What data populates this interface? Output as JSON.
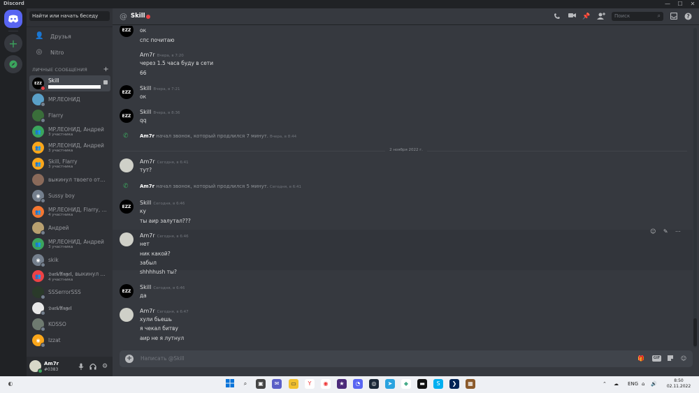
{
  "app": {
    "title": "Discord",
    "window_controls": [
      "—",
      "☐",
      "✕"
    ]
  },
  "guilds": {
    "home_icon": "discord-logo-icon",
    "add_icon": "plus-icon",
    "explore_icon": "compass-icon"
  },
  "sidebar": {
    "search_placeholder": "Найти или начать беседу",
    "nav": [
      {
        "label": "Друзья",
        "icon": "friends-icon"
      },
      {
        "label": "Nitro",
        "icon": "nitro-icon"
      }
    ],
    "dm_header": "ЛИЧНЫЕ СООБЩЕНИЯ",
    "dm_add": "+",
    "dms": [
      {
        "name": "Skill",
        "sub": "",
        "color": "#000000",
        "status": "dnd",
        "active": true,
        "avatar_text": "EZZ"
      },
      {
        "name": "MP.ЛЕОНИД",
        "sub": "",
        "color": "#5aa0c8",
        "status": "offline",
        "active": false,
        "avatar_text": ""
      },
      {
        "name": "Flarry",
        "sub": "",
        "color": "#3a6e3a",
        "status": "offline",
        "active": false,
        "avatar_text": ""
      },
      {
        "name": "MP.ЛЕОНИД, Андрей",
        "sub": "3 участника",
        "color": "#3ba55d",
        "status": "",
        "active": false,
        "avatar_text": "👥"
      },
      {
        "name": "MP.ЛЕОНИД, Андрей",
        "sub": "3 участника",
        "color": "#faa61a",
        "status": "",
        "active": false,
        "avatar_text": "👥"
      },
      {
        "name": "Skill, Flarry",
        "sub": "3 участника",
        "color": "#faa61a",
        "status": "",
        "active": false,
        "avatar_text": "👥"
      },
      {
        "name": "выкинул твоего отчи...",
        "sub": "",
        "color": "#8a6a5a",
        "status": "",
        "active": false,
        "avatar_text": ""
      },
      {
        "name": "Sussy boy",
        "sub": "",
        "color": "#747f8d",
        "status": "offline",
        "active": false,
        "avatar_text": "◉"
      },
      {
        "name": "MP.ЛЕОНИД, Flarry, ...",
        "sub": "4 участника",
        "color": "#f57731",
        "status": "",
        "active": false,
        "avatar_text": "👥"
      },
      {
        "name": "Андрей",
        "sub": "",
        "color": "#b8a070",
        "status": "offline",
        "active": false,
        "avatar_text": ""
      },
      {
        "name": "MP.ЛЕОНИД, Андрей",
        "sub": "3 участника",
        "color": "#3ba55d",
        "status": "",
        "active": false,
        "avatar_text": "👥"
      },
      {
        "name": "skik",
        "sub": "",
        "color": "#747f8d",
        "status": "offline",
        "active": false,
        "avatar_text": "◉"
      },
      {
        "name": "𝕯𝖆𝖗𝖐𝕬𝖓𝖌𝖊𝖑, выкинул ...",
        "sub": "4 участника",
        "color": "#ed4245",
        "status": "",
        "active": false,
        "avatar_text": "👥"
      },
      {
        "name": "SSSerrorSSS",
        "sub": "",
        "color": "#2a3a2a",
        "status": "mobile",
        "active": false,
        "avatar_text": ""
      },
      {
        "name": "𝕯𝖆𝖗𝖐𝕬𝖓𝖌𝖊𝖑",
        "sub": "",
        "color": "#e8e8e8",
        "status": "offline",
        "active": false,
        "avatar_text": ""
      },
      {
        "name": "KOSSO",
        "sub": "",
        "color": "#6e7a70",
        "status": "offline",
        "active": false,
        "avatar_text": ""
      },
      {
        "name": "Izzat",
        "sub": "",
        "color": "#faa61a",
        "status": "offline",
        "active": false,
        "avatar_text": "◉"
      }
    ]
  },
  "user_panel": {
    "username": "Am7r",
    "tag": "#0383",
    "mic_icon": "microphone-icon",
    "headphones_icon": "headphones-icon",
    "settings_icon": "gear-icon"
  },
  "channel": {
    "at": "@",
    "title": "Skill",
    "search_placeholder": "Поиск"
  },
  "messages": {
    "top_lines": [
      "ок",
      "спс почитаю"
    ],
    "m1": {
      "author": "Am7r",
      "time": "Вчера, в 7:20",
      "lines": [
        "через 1.5 часа буду в сети",
        "66"
      ]
    },
    "m2": {
      "author": "Skill",
      "time": "Вчера, в 7:21",
      "lines": [
        "ок"
      ]
    },
    "m3": {
      "author": "Skill",
      "time": "Вчера, в 8:36",
      "lines": [
        "qq"
      ]
    },
    "call1": {
      "author": "Am7r",
      "text": "начал звонок, который продлился 7 минут.",
      "time": "Вчера, в 8:44"
    },
    "date_divider": "2 ноября 2022 г.",
    "m4": {
      "author": "Am7r",
      "time": "Сегодня, в 6:41",
      "lines": [
        "тут?"
      ]
    },
    "call2": {
      "author": "Am7r",
      "text": "начал звонок, который продлился 5 минут.",
      "time": "Сегодня, в 6:41"
    },
    "m5": {
      "author": "Skill",
      "time": "Сегодня, в 6:46",
      "lines": [
        "ку",
        "ты аир залутал???"
      ]
    },
    "m6": {
      "author": "Am7r",
      "time": "Сегодня, в 6:46",
      "lines": [
        "нет",
        "ник какой?",
        "забыл",
        "shhhhush ты?"
      ]
    },
    "m7": {
      "author": "Skill",
      "time": "Сегодня, в 6:46",
      "lines": [
        "да"
      ]
    },
    "m8": {
      "author": "Am7r",
      "time": "Сегодня, в 6:47",
      "lines": [
        "хули бьешь",
        "я чекал битву",
        "аир не я лутнул"
      ]
    }
  },
  "composer": {
    "placeholder": "Написать @Skill",
    "gif_label": "GIF"
  },
  "taskbar": {
    "lang": "ENG",
    "time": "8:50",
    "date": "02.11.2022"
  }
}
